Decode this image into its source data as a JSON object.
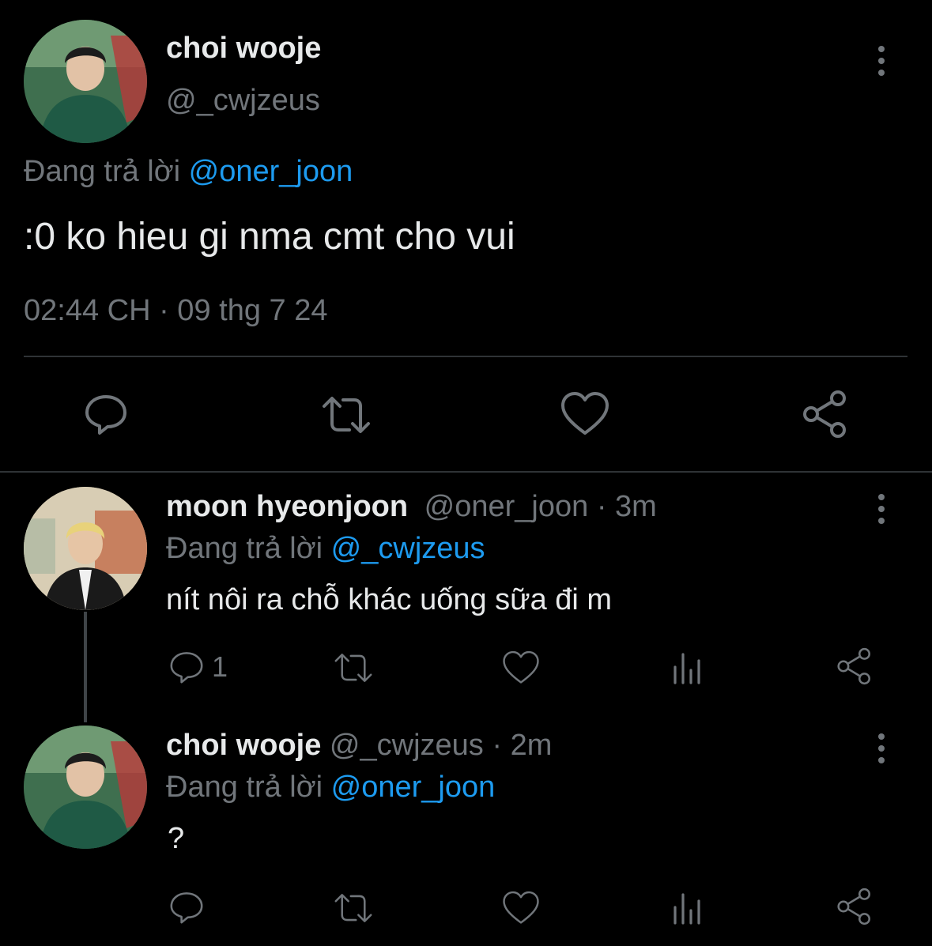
{
  "main_tweet": {
    "author_name": "choi wooje",
    "author_handle": "@_cwjzeus",
    "replying_prefix": "Đang trả lời",
    "replying_to": "@oner_joon",
    "text": ":0 ko hieu gi nma cmt cho vui",
    "timestamp": "02:44 CH · 09 thg 7 24",
    "actions": {
      "reply_icon": "reply-icon",
      "retweet_icon": "retweet-icon",
      "like_icon": "heart-icon",
      "share_icon": "share-icon"
    }
  },
  "replies": [
    {
      "author_name": "moon hyeonjoon",
      "author_handle": "@oner_joon",
      "time": "· 3m",
      "replying_prefix": "Đang trả lời",
      "replying_to": "@_cwjzeus",
      "text": "nít nôi ra chỗ khác uống sữa đi m",
      "reply_count": "1"
    },
    {
      "author_name": "choi wooje",
      "author_handle": "@_cwjzeus",
      "time": "· 2m",
      "replying_prefix": "Đang trả lời",
      "replying_to": "@oner_joon",
      "text": "?",
      "reply_count": ""
    }
  ],
  "colors": {
    "background": "#000000",
    "text": "#e7e9ea",
    "muted": "#71767b",
    "link": "#1d9bf0",
    "divider": "#2f3336"
  }
}
